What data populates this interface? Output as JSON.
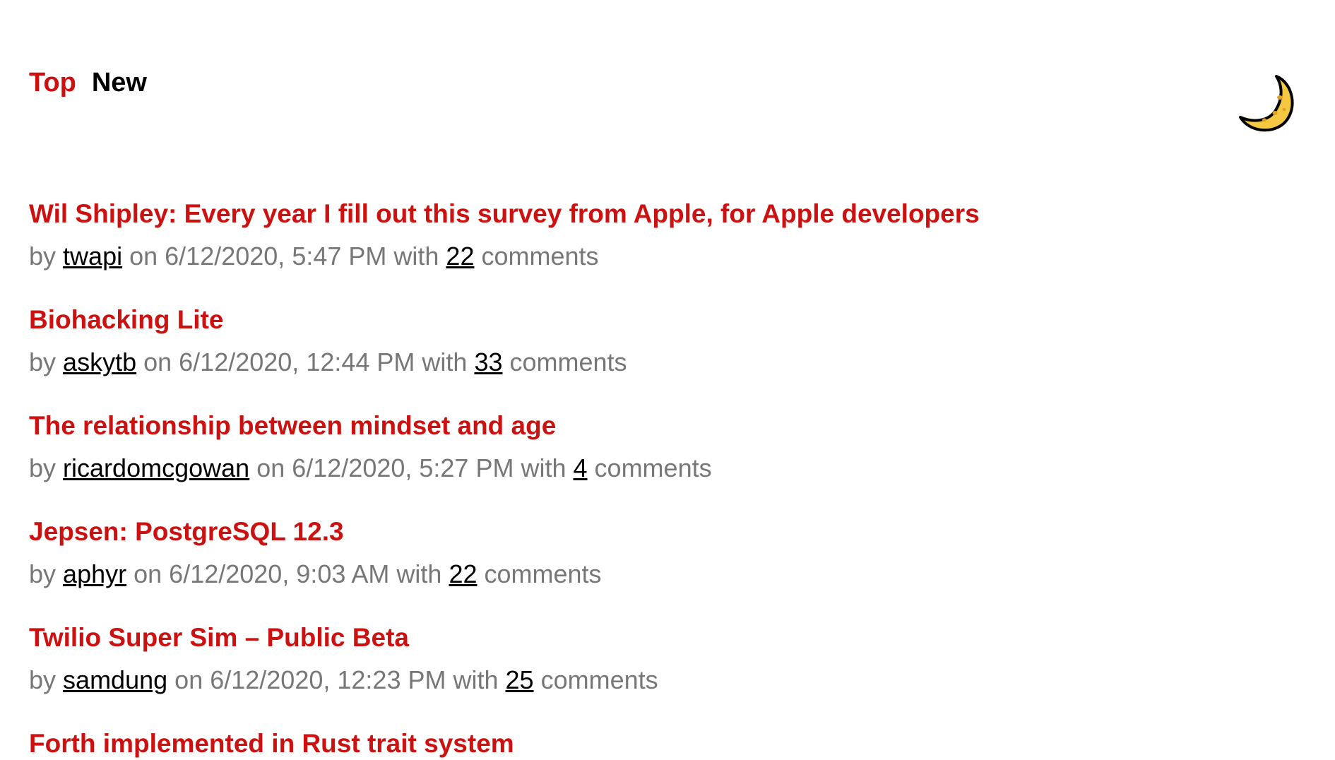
{
  "nav": {
    "tabs": [
      {
        "label": "Top"
      },
      {
        "label": "New"
      }
    ]
  },
  "theme_toggle": {
    "icon": "crescent-moon-icon",
    "colors": {
      "fill": "#f5c842",
      "outline": "#000000",
      "spots": "#e0a020"
    }
  },
  "colors": {
    "accent": "#cc1111",
    "meta_text": "#777777",
    "link_text": "#000000"
  },
  "stories": [
    {
      "title": "Wil Shipley: Every year I fill out this survey from Apple, for Apple developers",
      "by": "by",
      "author": "twapi",
      "on": "on 6/12/2020, 5:47 PM with",
      "comments_count": "22",
      "comments_label": "comments"
    },
    {
      "title": "Biohacking Lite",
      "by": "by",
      "author": "askytb",
      "on": "on 6/12/2020, 12:44 PM with",
      "comments_count": "33",
      "comments_label": "comments"
    },
    {
      "title": "The relationship between mindset and age",
      "by": "by",
      "author": "ricardomcgowan",
      "on": "on 6/12/2020, 5:27 PM with",
      "comments_count": "4",
      "comments_label": "comments"
    },
    {
      "title": "Jepsen: PostgreSQL 12.3",
      "by": "by",
      "author": "aphyr",
      "on": "on 6/12/2020, 9:03 AM with",
      "comments_count": "22",
      "comments_label": "comments"
    },
    {
      "title": "Twilio Super Sim – Public Beta",
      "by": "by",
      "author": "samdung",
      "on": "on 6/12/2020, 12:23 PM with",
      "comments_count": "25",
      "comments_label": "comments"
    },
    {
      "title": "Forth implemented in Rust trait system",
      "by": "",
      "author": "",
      "on": "",
      "comments_count": "",
      "comments_label": ""
    }
  ]
}
